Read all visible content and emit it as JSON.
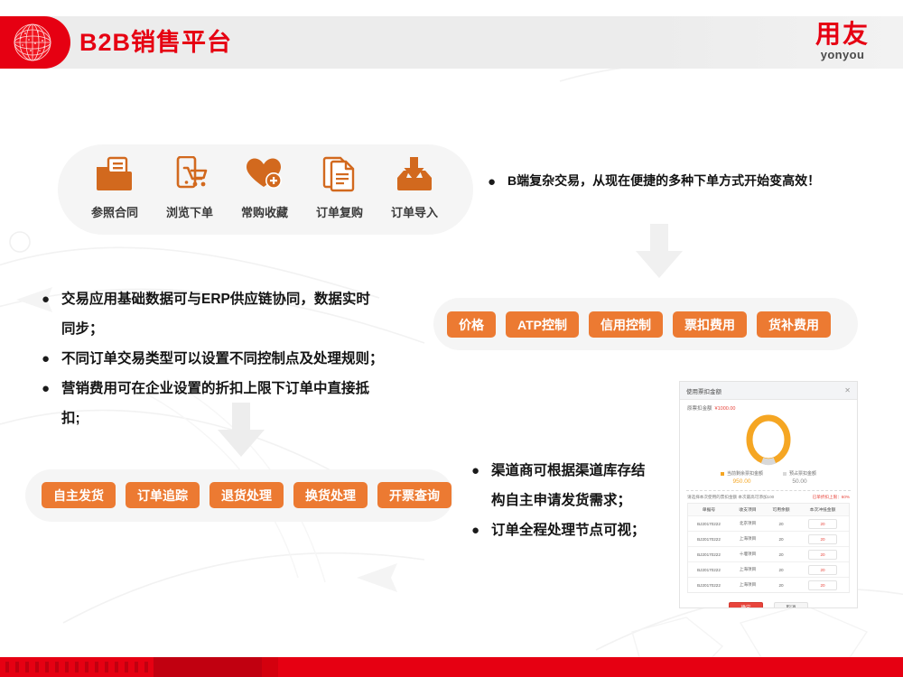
{
  "header": {
    "title": "B2B销售平台",
    "logo_cn": "用友",
    "logo_en": "yonyou",
    "globe_icon": "globe-icon",
    "brand_red": "#e60012"
  },
  "icon_row": {
    "items": [
      {
        "icon": "folder-contract-icon",
        "label": "参照合同"
      },
      {
        "icon": "mobile-cart-icon",
        "label": "浏览下单"
      },
      {
        "icon": "heart-plus-icon",
        "label": "常购收藏"
      },
      {
        "icon": "document-icon",
        "label": "订单复购"
      },
      {
        "icon": "download-inbox-icon",
        "label": "订单导入"
      }
    ],
    "accent": "#d2691e"
  },
  "bullets_top": [
    "B端复杂交易，从现在便捷的多种下单方式开始变高效！"
  ],
  "bullets_left": [
    "交易应用基础数据可与ERP供应链协同，数据实时",
    "同步；",
    "不同订单交易类型可以设置不同控制点及处理规则；",
    "营销费用可在企业设置的折扣上限下订单中直接抵",
    "扣;"
  ],
  "bullets_left_marks": [
    true,
    false,
    true,
    true,
    false
  ],
  "bullets_right": [
    "渠道商可根据渠道库存结",
    "构自主申请发货需求；",
    "订单全程处理节点可视；"
  ],
  "bullets_right_marks": [
    true,
    false,
    true
  ],
  "tags_right": [
    "价格",
    "ATP控制",
    "信用控制",
    "票扣费用",
    "货补费用"
  ],
  "tags_bottom": [
    "自主发货",
    "订单追踪",
    "退货处理",
    "换货处理",
    "开票查询"
  ],
  "tag_color": "#ec7a32",
  "arrows": [
    {
      "name": "down-arrow-right",
      "color": "#f0f0f0"
    },
    {
      "name": "down-arrow-left",
      "color": "#ededed"
    },
    {
      "name": "down-arrow-left-lower",
      "color": "#ededed"
    }
  ],
  "screenshot": {
    "title": "使用票扣金额",
    "close_icon": "close-icon",
    "subtitle_label": "原票扣金额",
    "subtitle_amount": "¥1000.00",
    "donut": {
      "used_color": "#f5a623",
      "reserved_color": "#d8d8d8",
      "used_value": "950.00",
      "reserved_value": "50.00"
    },
    "legend": [
      {
        "swatch": "orange",
        "label": "当前剩余票扣金额",
        "value": "950.00"
      },
      {
        "swatch": "gray",
        "label": "预占票扣金额",
        "value": "50.00"
      }
    ],
    "note_left": "请选择本次使用的票扣金额 本次最高可添加100",
    "note_right": "已单折扣上限：60%",
    "table": {
      "columns": [
        "单据号",
        "收支项目",
        "可用余额",
        "本次冲抵金额"
      ],
      "rows": [
        [
          "BJ20170222",
          "北京项目",
          "20",
          "20"
        ],
        [
          "BJ20170222",
          "上海项目",
          "20",
          "20"
        ],
        [
          "BJ20170222",
          "十堰项目",
          "20",
          "20"
        ],
        [
          "BJ20170222",
          "上海项目",
          "20",
          "20"
        ],
        [
          "BJ20170222",
          "上海项目",
          "20",
          "20"
        ]
      ]
    },
    "buttons": {
      "ok": "确定",
      "cancel": "取消"
    }
  }
}
